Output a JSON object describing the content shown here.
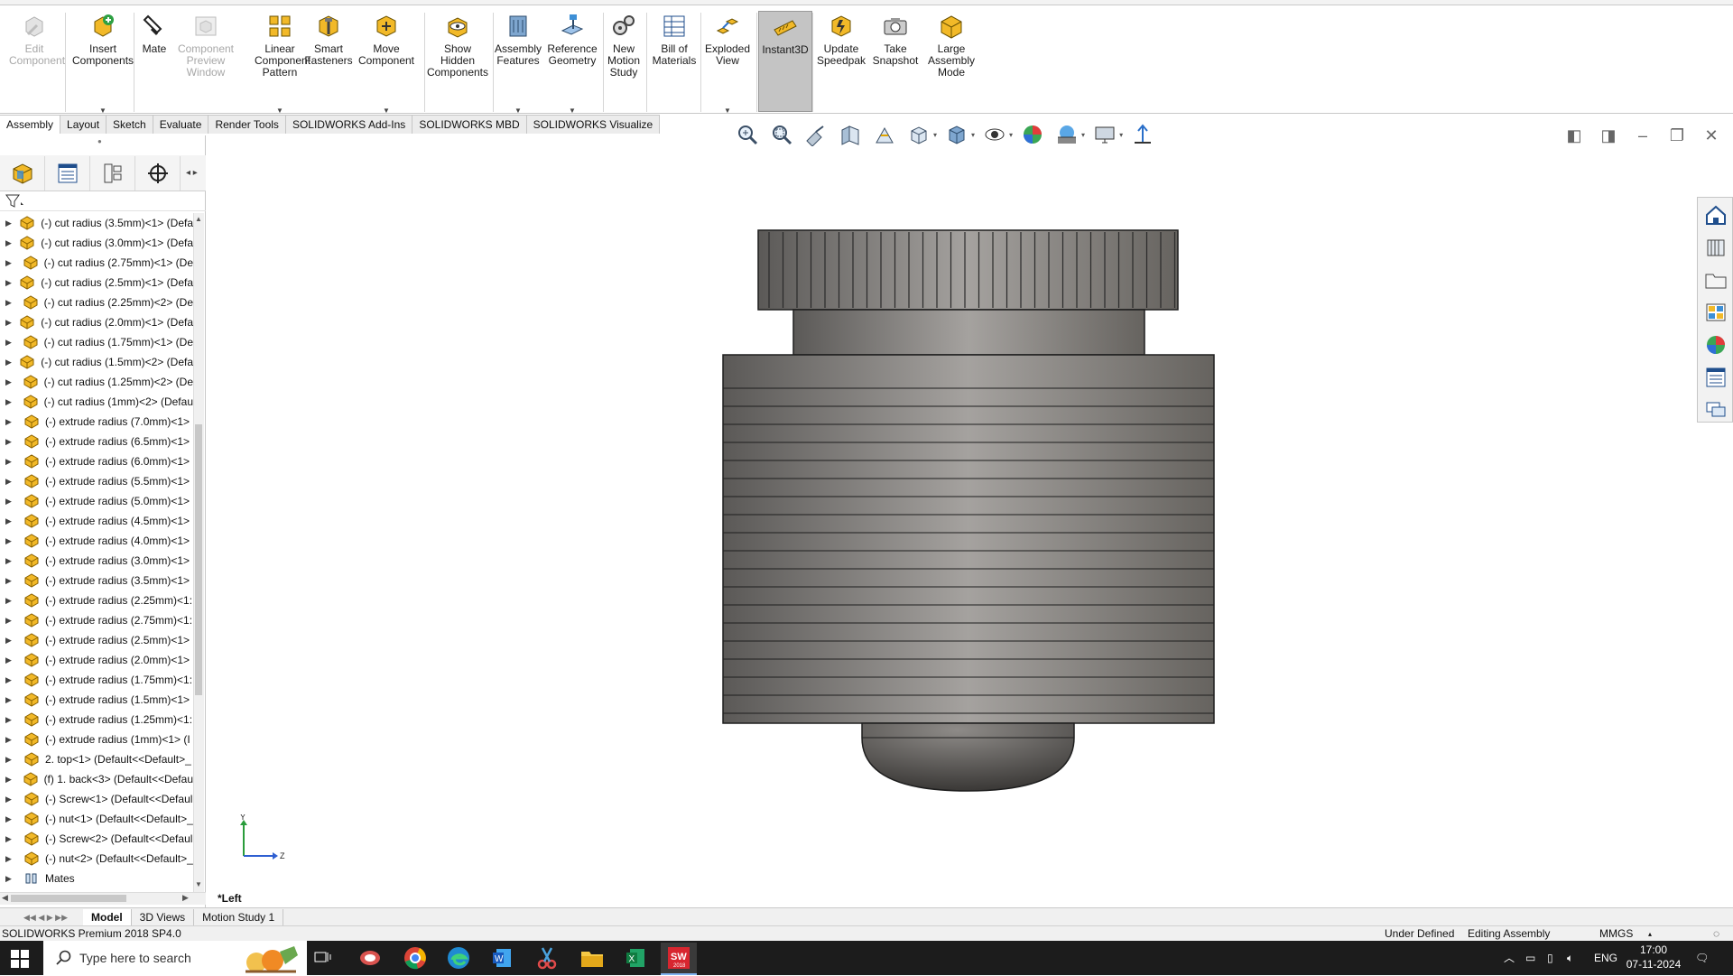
{
  "ribbon": {
    "buttons": [
      {
        "id": "edit-component",
        "label": "Edit\nComponent",
        "enabled": false
      },
      {
        "id": "insert-components",
        "label": "Insert\nComponents",
        "enabled": true
      },
      {
        "id": "mate",
        "label": "Mate",
        "enabled": true
      },
      {
        "id": "component-preview-window",
        "label": "Component\nPreview\nWindow",
        "enabled": false
      },
      {
        "id": "linear-component-pattern",
        "label": "Linear\nComponent\nPattern",
        "enabled": true
      },
      {
        "id": "smart-fasteners",
        "label": "Smart\nFasteners",
        "enabled": true
      },
      {
        "id": "move-component",
        "label": "Move\nComponent",
        "enabled": true
      },
      {
        "id": "show-hidden-components",
        "label": "Show\nHidden\nComponents",
        "enabled": true
      },
      {
        "id": "assembly-features",
        "label": "Assembly\nFeatures",
        "enabled": true
      },
      {
        "id": "reference-geometry",
        "label": "Reference\nGeometry",
        "enabled": true
      },
      {
        "id": "new-motion-study",
        "label": "New\nMotion\nStudy",
        "enabled": true
      },
      {
        "id": "bill-of-materials",
        "label": "Bill of\nMaterials",
        "enabled": true
      },
      {
        "id": "exploded-view",
        "label": "Exploded\nView",
        "enabled": true
      },
      {
        "id": "instant3d",
        "label": "Instant3D",
        "enabled": true,
        "active": true
      },
      {
        "id": "update-speedpak",
        "label": "Update\nSpeedpak",
        "enabled": true
      },
      {
        "id": "take-snapshot",
        "label": "Take\nSnapshot",
        "enabled": true
      },
      {
        "id": "large-assembly-mode",
        "label": "Large\nAssembly\nMode",
        "enabled": true
      }
    ]
  },
  "command_tabs": [
    "Assembly",
    "Layout",
    "Sketch",
    "Evaluate",
    "Render Tools",
    "SOLIDWORKS Add-Ins",
    "SOLIDWORKS MBD",
    "SOLIDWORKS Visualize"
  ],
  "active_command_tab": "Assembly",
  "tree": {
    "items": [
      "(-) cut radius (3.5mm)<1> (Defa",
      "(-) cut radius (3.0mm)<1> (Defa",
      "(-) cut radius (2.75mm)<1> (De",
      "(-) cut radius (2.5mm)<1> (Defa",
      "(-) cut radius (2.25mm)<2> (De",
      "(-) cut radius (2.0mm)<1> (Defa",
      "(-) cut radius (1.75mm)<1> (De",
      "(-) cut radius (1.5mm)<2> (Defa",
      "(-) cut radius (1.25mm)<2> (De",
      "(-) cut radius (1mm)<2> (Defau",
      "(-) extrude  radius (7.0mm)<1>",
      "(-) extrude  radius (6.5mm)<1>",
      "(-) extrude  radius (6.0mm)<1>",
      "(-) extrude  radius (5.5mm)<1>",
      "(-) extrude  radius (5.0mm)<1>",
      "(-) extrude  radius (4.5mm)<1>",
      "(-) extrude  radius (4.0mm)<1>",
      "(-) extrude  radius (3.0mm)<1>",
      "(-) extrude  radius (3.5mm)<1>",
      "(-) extrude  radius (2.25mm)<1:",
      "(-) extrude  radius (2.75mm)<1:",
      "(-) extrude  radius (2.5mm)<1>",
      "(-) extrude  radius (2.0mm)<1>",
      "(-) extrude  radius (1.75mm)<1:",
      "(-) extrude  radius (1.5mm)<1>",
      "(-) extrude  radius (1.25mm)<1:",
      "(-) extrude  radius (1mm)<1> (I",
      "2. top<1> (Default<<Default>_",
      "(f) 1. back<3> (Default<<Defau",
      "(-) Screw<1> (Default<<Defaul",
      "(-) nut<1> (Default<<Default>_",
      "(-) Screw<2> (Default<<Defaul",
      "(-) nut<2> (Default<<Default>_"
    ],
    "mates_label": "Mates"
  },
  "viewport": {
    "view_label": "*Left",
    "triad": {
      "y": "Y",
      "z": "Z"
    }
  },
  "bottom_tabs": [
    "Model",
    "3D Views",
    "Motion Study 1"
  ],
  "active_bottom_tab": "Model",
  "status": {
    "product": "SOLIDWORKS Premium 2018 SP4.0",
    "definition": "Under Defined",
    "mode": "Editing Assembly",
    "units": "MMGS"
  },
  "taskbar": {
    "search_placeholder": "Type here to search",
    "language": "ENG",
    "time": "17:00",
    "date": "07-11-2024"
  },
  "colors": {
    "model_body": "#8f8c89",
    "model_highlight": "#b4b2ae",
    "model_edge": "#1e1e1e",
    "active_tab_bg": "#c4c4c4",
    "taskbar_bg": "#1c1c1c",
    "tree_icon": "#e8a317"
  }
}
